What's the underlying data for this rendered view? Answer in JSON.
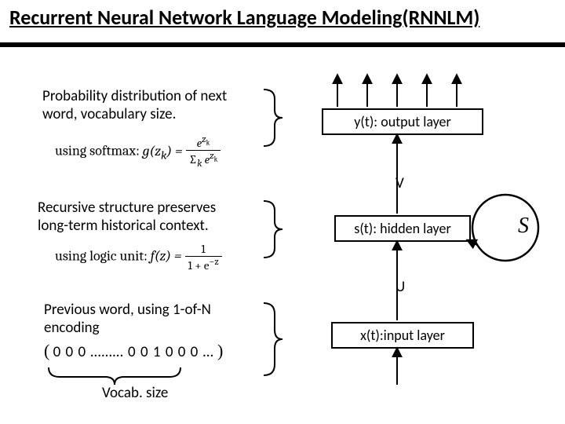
{
  "title": "Recurrent Neural Network Language Modeling(RNNLM)",
  "notes": {
    "output_note": "Probability distribution of next word, vocabulary size.",
    "softmax_prefix": "using softmax:",
    "softmax_lhs": "g(z",
    "softmax_sub": "k",
    "softmax_rhs_eq": ") =",
    "softmax_num": "e",
    "softmax_num_sup": "z",
    "softmax_num_sup2": "k",
    "softmax_den_pre": "∑",
    "softmax_den_sub": "k",
    "softmax_den_e": "e",
    "softmax_den_sup": "z",
    "softmax_den_sup2": "k",
    "hidden_note": "Recursive structure preserves long-term historical context.",
    "logic_prefix": "using logic unit:",
    "logic_lhs": "f(z) =",
    "logic_num": "1",
    "logic_den_pre": "1 + e",
    "logic_den_sup": "−z",
    "input_note_l1": "Previous word, using 1-of-N encoding",
    "input_note_l2": "0 0 0 ……… 0 0 1 0 0 0 …",
    "vocab_label": "Vocab. size"
  },
  "layers": {
    "output": "y(t): output layer",
    "hidden": "s(t): hidden layer",
    "input": "x(t):input layer"
  },
  "matrices": {
    "V": "V",
    "U": "U",
    "S": "S"
  }
}
